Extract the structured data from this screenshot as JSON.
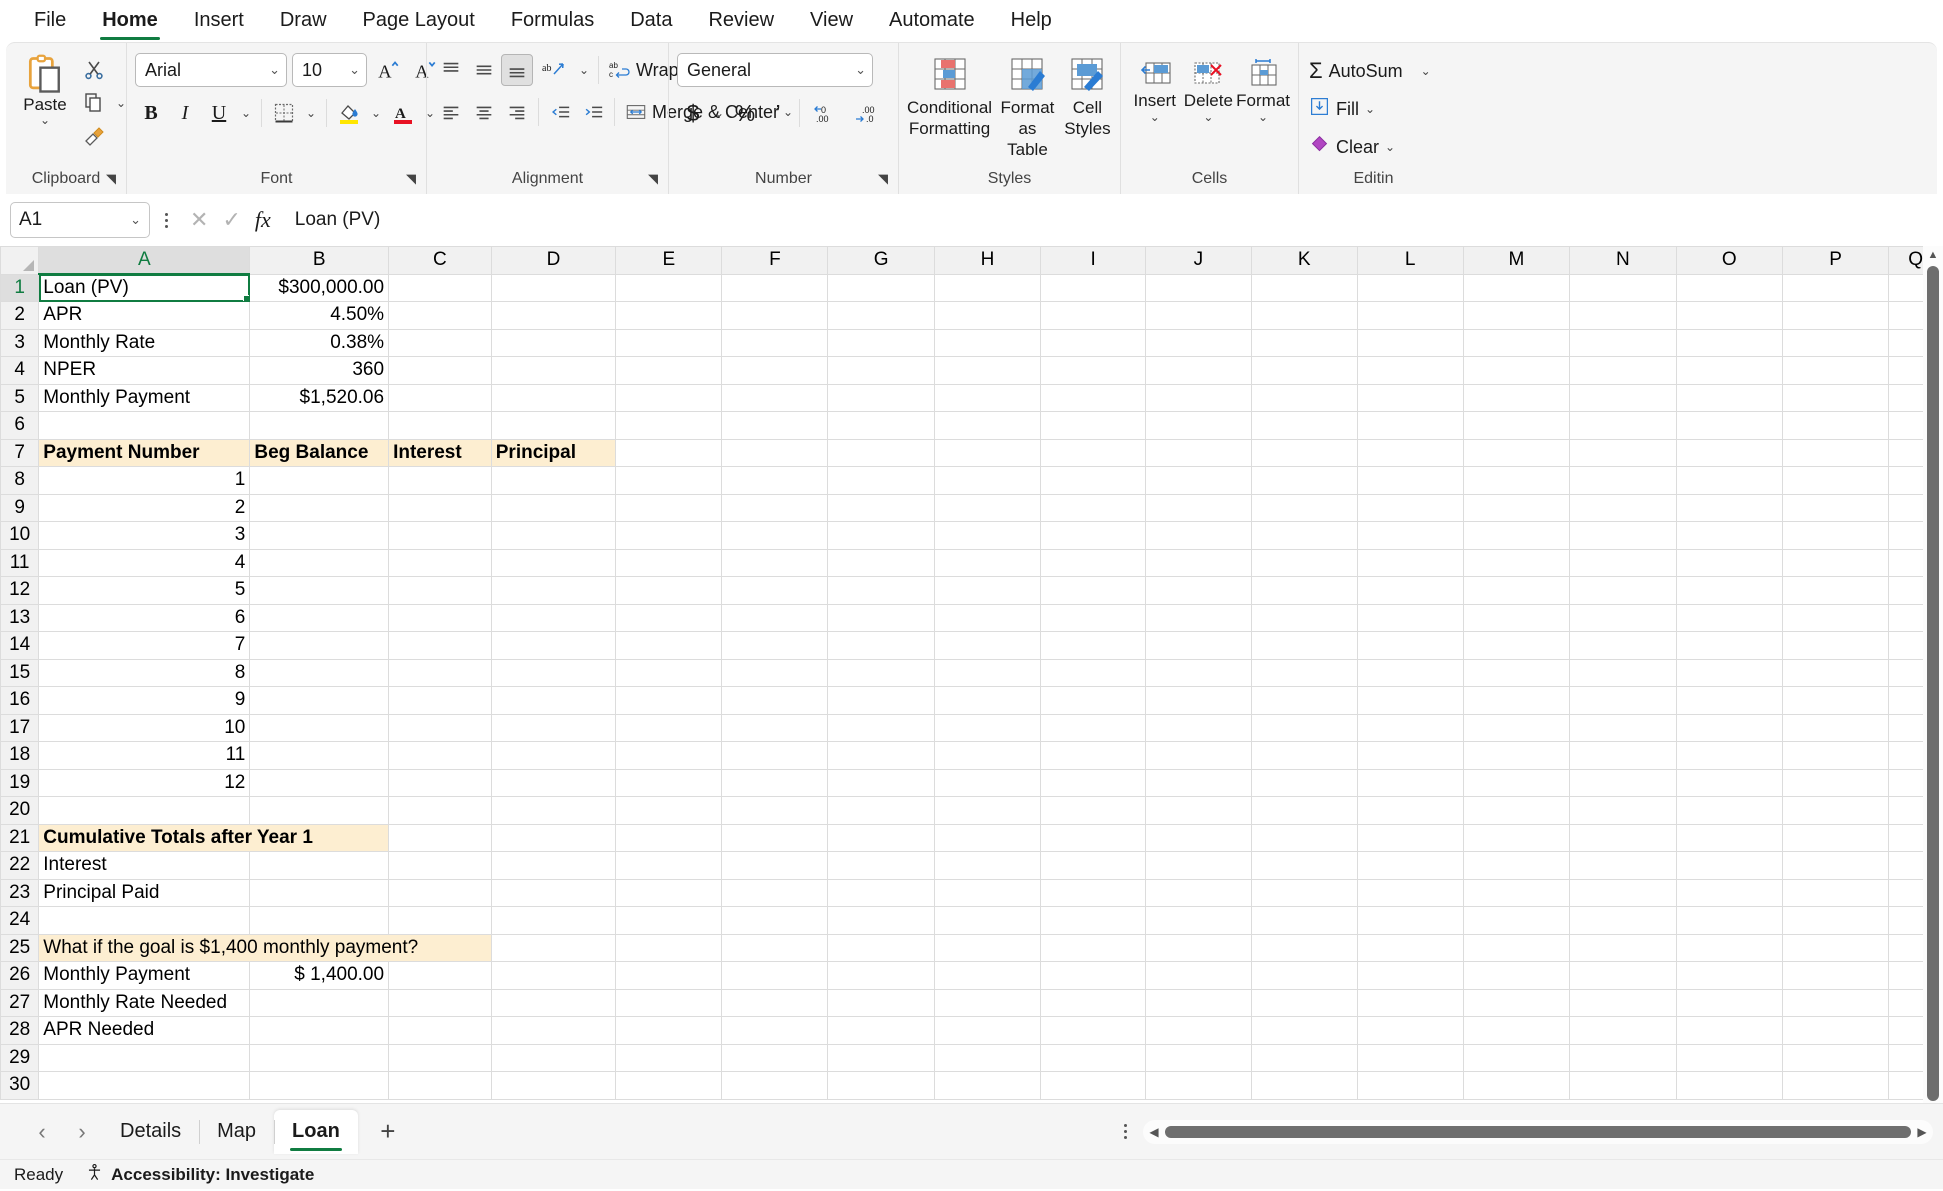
{
  "ribbon": {
    "tabs": [
      {
        "label": "File",
        "active": false
      },
      {
        "label": "Home",
        "active": true
      },
      {
        "label": "Insert",
        "active": false
      },
      {
        "label": "Draw",
        "active": false
      },
      {
        "label": "Page Layout",
        "active": false
      },
      {
        "label": "Formulas",
        "active": false
      },
      {
        "label": "Data",
        "active": false
      },
      {
        "label": "Review",
        "active": false
      },
      {
        "label": "View",
        "active": false
      },
      {
        "label": "Automate",
        "active": false
      },
      {
        "label": "Help",
        "active": false
      }
    ],
    "clipboard": {
      "group_label": "Clipboard",
      "paste_label": "Paste",
      "cut_icon": "scissors-icon",
      "copy_icon": "copy-icon",
      "format_painter_icon": "format-painter-icon"
    },
    "font": {
      "group_label": "Font",
      "font_name": "Arial",
      "font_size": "10",
      "grow_font": "A",
      "shrink_font": "A",
      "bold": "B",
      "italic": "I",
      "underline": "U"
    },
    "alignment": {
      "group_label": "Alignment",
      "wrap_text": "Wrap Text",
      "merge_center": "Merge & Center"
    },
    "number": {
      "group_label": "Number",
      "format": "General",
      "currency": "$",
      "percent": "%",
      "comma": "’",
      "increase_decimal": ".00",
      "decrease_decimal": ".00"
    },
    "styles": {
      "group_label": "Styles",
      "conditional_formatting": "Conditional Formatting",
      "format_as_table": "Format as Table",
      "cell_styles": "Cell Styles"
    },
    "cells": {
      "group_label": "Cells",
      "insert": "Insert",
      "delete": "Delete",
      "format": "Format"
    },
    "editing": {
      "group_label": "Editin",
      "autosum": "AutoSum",
      "fill": "Fill",
      "clear": "Clear"
    }
  },
  "formula_bar": {
    "name_box": "A1",
    "fx_label": "fx",
    "formula_value": "Loan (PV)"
  },
  "grid": {
    "columns": [
      "A",
      "B",
      "C",
      "D",
      "E",
      "F",
      "G",
      "H",
      "I",
      "J",
      "K",
      "L",
      "M",
      "N",
      "O",
      "P",
      "Q"
    ],
    "selected_column": "A",
    "selected_row": 1,
    "selected_cell": "A1",
    "rows": [
      {
        "n": 1,
        "cells": [
          {
            "v": "Loan (PV)",
            "a": "left",
            "sel": true
          },
          {
            "v": "$300,000.00",
            "a": "right"
          }
        ]
      },
      {
        "n": 2,
        "cells": [
          {
            "v": "APR",
            "a": "left"
          },
          {
            "v": "4.50%",
            "a": "right"
          }
        ]
      },
      {
        "n": 3,
        "cells": [
          {
            "v": "Monthly Rate",
            "a": "left"
          },
          {
            "v": "0.38%",
            "a": "right"
          }
        ]
      },
      {
        "n": 4,
        "cells": [
          {
            "v": "NPER",
            "a": "left"
          },
          {
            "v": "360",
            "a": "right"
          }
        ]
      },
      {
        "n": 5,
        "cells": [
          {
            "v": "Monthly Payment",
            "a": "left"
          },
          {
            "v": "$1,520.06",
            "a": "right"
          }
        ]
      },
      {
        "n": 6,
        "cells": []
      },
      {
        "n": 7,
        "cells": [
          {
            "v": "Payment Number",
            "a": "left",
            "hl": true,
            "b": true
          },
          {
            "v": "Beg Balance",
            "a": "left",
            "hl": true,
            "b": true
          },
          {
            "v": "Interest",
            "a": "left",
            "hl": true,
            "b": true
          },
          {
            "v": "Principal",
            "a": "left",
            "hl": true,
            "b": true
          }
        ]
      },
      {
        "n": 8,
        "cells": [
          {
            "v": "1",
            "a": "right"
          }
        ]
      },
      {
        "n": 9,
        "cells": [
          {
            "v": "2",
            "a": "right"
          }
        ]
      },
      {
        "n": 10,
        "cells": [
          {
            "v": "3",
            "a": "right"
          }
        ]
      },
      {
        "n": 11,
        "cells": [
          {
            "v": "4",
            "a": "right"
          }
        ]
      },
      {
        "n": 12,
        "cells": [
          {
            "v": "5",
            "a": "right"
          }
        ]
      },
      {
        "n": 13,
        "cells": [
          {
            "v": "6",
            "a": "right"
          }
        ]
      },
      {
        "n": 14,
        "cells": [
          {
            "v": "7",
            "a": "right"
          }
        ]
      },
      {
        "n": 15,
        "cells": [
          {
            "v": "8",
            "a": "right"
          }
        ]
      },
      {
        "n": 16,
        "cells": [
          {
            "v": "9",
            "a": "right"
          }
        ]
      },
      {
        "n": 17,
        "cells": [
          {
            "v": "10",
            "a": "right"
          }
        ]
      },
      {
        "n": 18,
        "cells": [
          {
            "v": "11",
            "a": "right"
          }
        ]
      },
      {
        "n": 19,
        "cells": [
          {
            "v": "12",
            "a": "right"
          }
        ]
      },
      {
        "n": 20,
        "cells": []
      },
      {
        "n": 21,
        "cells": [
          {
            "v": "Cumulative Totals after Year 1",
            "a": "left",
            "hl": true,
            "b": true,
            "span": 2
          }
        ]
      },
      {
        "n": 22,
        "cells": [
          {
            "v": "Interest",
            "a": "left"
          }
        ]
      },
      {
        "n": 23,
        "cells": [
          {
            "v": "Principal Paid",
            "a": "left"
          }
        ]
      },
      {
        "n": 24,
        "cells": []
      },
      {
        "n": 25,
        "cells": [
          {
            "v": "What if the goal is $1,400 monthly payment?",
            "a": "left",
            "hl": true,
            "span": 3
          }
        ]
      },
      {
        "n": 26,
        "cells": [
          {
            "v": "Monthly Payment",
            "a": "left"
          },
          {
            "v": "$    1,400.00",
            "a": "right"
          }
        ]
      },
      {
        "n": 27,
        "cells": [
          {
            "v": "Monthly Rate Needed",
            "a": "left"
          }
        ]
      },
      {
        "n": 28,
        "cells": [
          {
            "v": "APR Needed",
            "a": "left"
          }
        ]
      },
      {
        "n": 29,
        "cells": []
      },
      {
        "n": 30,
        "cells": []
      }
    ]
  },
  "sheet_tabs": {
    "prev": "‹",
    "next": "›",
    "tabs": [
      {
        "label": "Details",
        "active": false
      },
      {
        "label": "Map",
        "active": false
      },
      {
        "label": "Loan",
        "active": true
      }
    ],
    "add": "+"
  },
  "status_bar": {
    "state": "Ready",
    "accessibility": "Accessibility: Investigate"
  },
  "colors": {
    "accent_green": "#107c41",
    "highlight_cell": "#fdeed1",
    "header_gray": "#f1f1f1"
  }
}
